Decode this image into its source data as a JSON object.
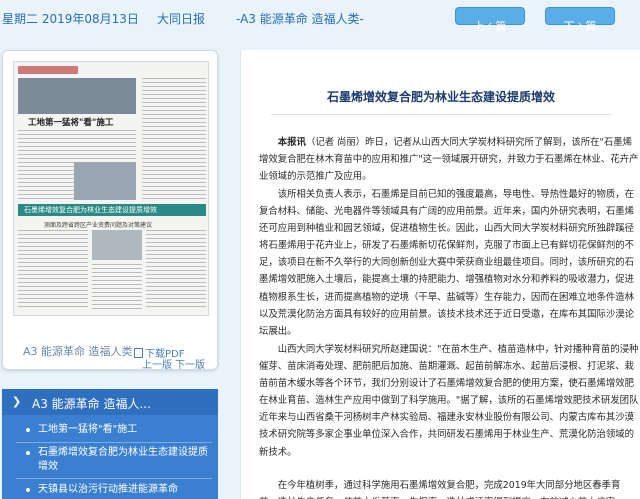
{
  "topbar": {
    "date": "星期二 2019年08月13日",
    "paper": "大同日报",
    "section": "-A3 能源革命 造福人类-",
    "prev": "上一篇",
    "next": "下一篇"
  },
  "thumbnail": {
    "headline_main": "工地第一猛将\"看\"施工",
    "band_text": "石墨烯增效复合肥为林业生态建设提质增效",
    "sub_text": "测面及跨省跨区产业资费问题及对策建议",
    "caption": "A3 能源革命 造福人类",
    "pdf_label": "下载PDF",
    "prev_page": "上一版",
    "next_page": "下一版"
  },
  "section_list": {
    "title": "A3  能源革命 造福人...",
    "items": [
      "工地第一猛将\"看\"施工",
      "石墨烯增效复合肥为林业生态建设提质增效",
      "天镇县以治污行动推进能源革命"
    ]
  },
  "article": {
    "title": "石墨烯增效复合肥为林业生态建设提质增效",
    "lead_bold": "本报讯",
    "p1_rest": "（记者 尚丽）昨日，记者从山西大同大学炭材料研究所了解到，该所在\"石墨烯增效复合肥在林木育苗中的应用和推广\"这一领域展开研究，并致力于石墨烯在林业、花卉产业领域的示范推广及应用。",
    "p2": "该所相关负责人表示，石墨烯是目前已知的强度最高，导电性、导热性最好的物质，在复合材料、储能、光电器件等领域具有广阔的应用前景。近年来，国内外研究表明，石墨烯还可应用到种植业和园艺领域，促进植物生长。因此，山西大同大学炭材料研究所独辟蹊径将石墨烯用于花卉业上，研发了石墨烯新切花保鲜剂，克服了市面上已有鲜切花保鲜剂的不足，该项目在新不久举行的大同创新创业大赛中荣获商业组最佳项目。同时，该所研究的石墨烯增效肥施入土壤后，能提高土壤的持肥能力、增强植物对水分和养料的吸收潜力，促进植物根系生长，进而提高植物的逆境（干旱、盐碱等）生存能力，因而在困难立地条件造林以及荒漠化防治方面具有较好的应用前景。该技术技术还于近日受邀，在库布其国际沙漠论坛展出。",
    "p3": "山西大同大学炭材料研究所赵建国说：\"在苗木生产、植苗造林中，针对播种育苗的浸种催芽、苗床消毒处理、肥前肥后加施、苗期灌溉、起苗前解冻水、起苗后浸根、打泥浆、栽苗前苗木缓水等各个环节，我们分别设计了石墨烯增效复合肥的使用方案，使石墨烯增效肥在林业育苗、造林生产应用中做到了科学施用。\"据了解，该所的石墨烯增效肥技术研发团队近年来与山西省桑干河杨树丰产林实验局、福建永安林业股份有限公司、内蒙古库布其沙漠技术研究院等多家企事业单位深入合作，共同研发石墨烯用于林业生产、荒漠化防治领域的新技术。",
    "p4": "在今年植树季，通过科学施用石墨烯增效复合肥，完成2019年大同部分地区春季育苗、造林生产任务，使苗木发芽率、生根率、造林成活率得到提高，有效减少苗木病害。"
  }
}
